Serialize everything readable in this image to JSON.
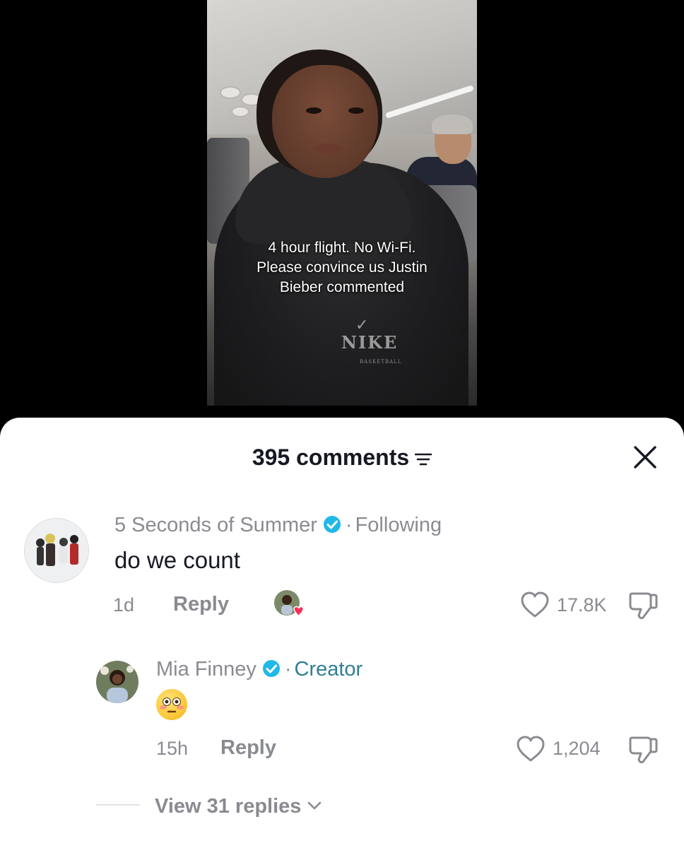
{
  "video": {
    "caption_lines": [
      "4 hour flight. No Wi-Fi.",
      "Please convince us Justin",
      "Bieber commented"
    ],
    "hoodie_logo": "NIKE",
    "hoodie_logo_sub": "BASKETBALL"
  },
  "comments_sheet": {
    "title": "395 comments",
    "filter_icon": "filter-icon",
    "close_icon": "close-icon"
  },
  "comments": [
    {
      "username": "5 Seconds of Summer",
      "verified": true,
      "relationship": "Following",
      "text": "do we count",
      "age": "1d",
      "reply_label": "Reply",
      "liked_by_creator": true,
      "likes": "17.8K"
    },
    {
      "username": "Mia Finney",
      "verified": true,
      "relationship": "Creator",
      "text": "😳",
      "age": "15h",
      "reply_label": "Reply",
      "likes": "1,204"
    }
  ],
  "view_replies": "View 31 replies",
  "colors": {
    "text_primary": "#161823",
    "text_secondary": "#8a8b91",
    "verified_blue": "#20b8e8",
    "creator_teal": "#2f7f93",
    "heart_red": "#fe2c55"
  }
}
